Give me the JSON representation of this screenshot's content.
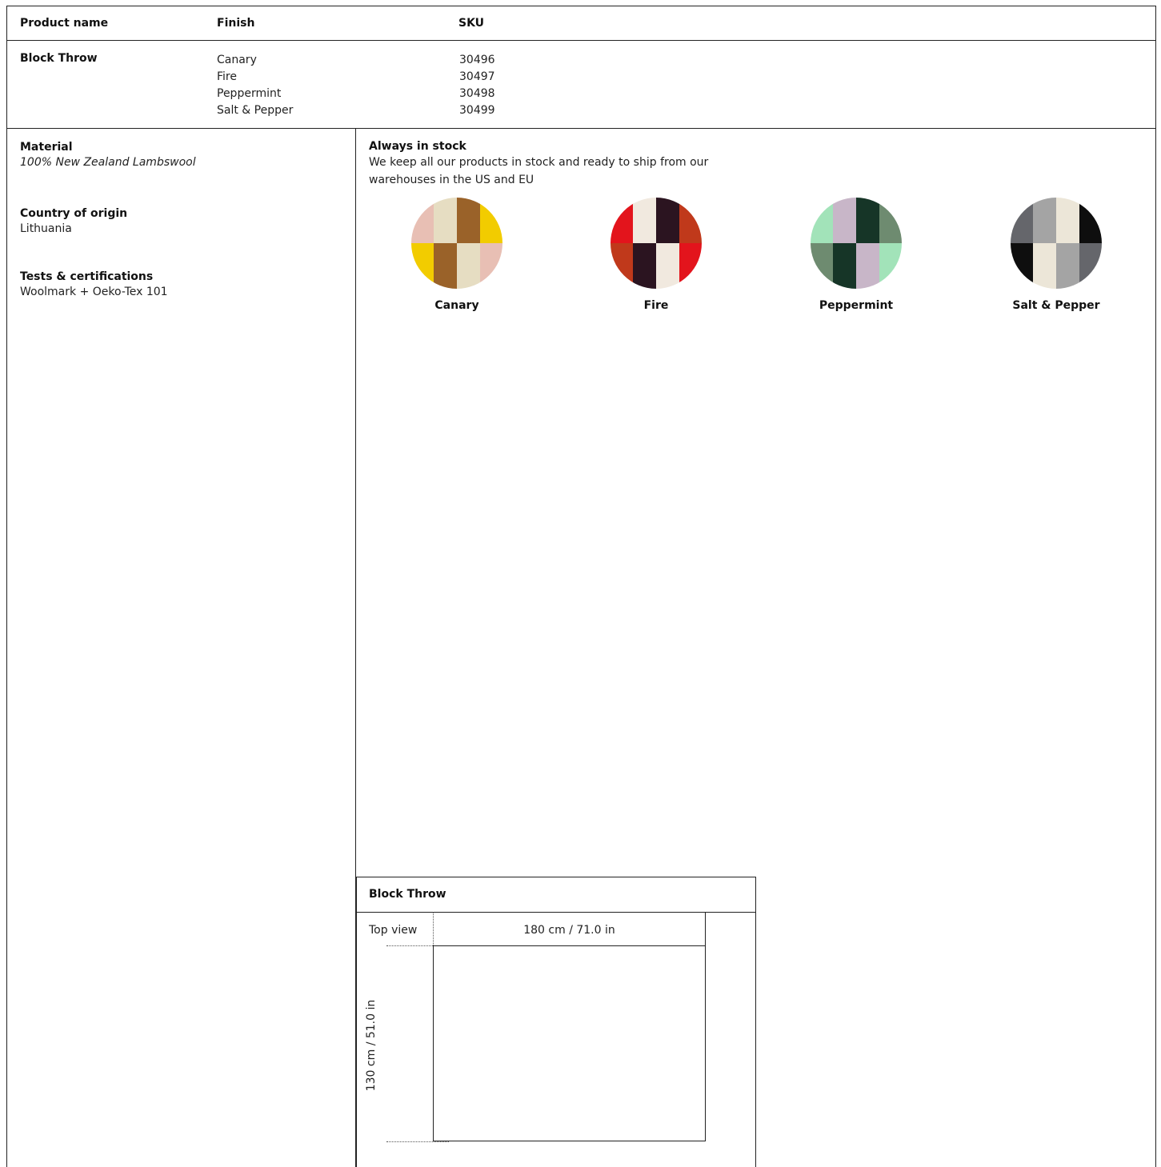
{
  "table": {
    "headers": {
      "product_name": "Product name",
      "finish": "Finish",
      "sku": "SKU"
    },
    "product_name": "Block Throw",
    "finishes": [
      "Canary",
      "Fire",
      "Peppermint",
      "Salt & Pepper"
    ],
    "skus": [
      "30496",
      "30497",
      "30498",
      "30499"
    ]
  },
  "specs": {
    "material_label": "Material",
    "material_value": "100% New Zealand Lambswool",
    "origin_label": "Country of origin",
    "origin_value": "Lithuania",
    "tests_label": "Tests & certifications",
    "tests_value": "Woolmark + Oeko-Tex 101"
  },
  "stock": {
    "label": "Always in stock",
    "line1": "We keep all our products in stock and ready to ship from our",
    "line2": "warehouses in the US and EU"
  },
  "swatches": [
    {
      "name": "Canary",
      "colors": [
        "#e8bfb4",
        "#e6ddc2",
        "#9a6229",
        "#f2cc00",
        "#f2cc00",
        "#9a6229",
        "#e6ddc2",
        "#e8bfb4"
      ]
    },
    {
      "name": "Fire",
      "colors": [
        "#e3141c",
        "#f1e9df",
        "#2b1420",
        "#c0391b",
        "#c0391b",
        "#2b1420",
        "#f1e9df",
        "#e3141c"
      ]
    },
    {
      "name": "Peppermint",
      "colors": [
        "#a2e3b9",
        "#c8b6c8",
        "#163527",
        "#6e8b70",
        "#6e8b70",
        "#163527",
        "#c8b6c8",
        "#a2e3b9"
      ]
    },
    {
      "name": "Salt & Pepper",
      "colors": [
        "#65666b",
        "#a4a4a4",
        "#ece6d8",
        "#0e0e0e",
        "#0e0e0e",
        "#ece6d8",
        "#a4a4a4",
        "#65666b"
      ]
    }
  ],
  "dimensions": {
    "title": "Block Throw",
    "view_label": "Top view",
    "width_label": "180 cm / 71.0 in",
    "height_label": "130 cm / 51.0 in"
  }
}
